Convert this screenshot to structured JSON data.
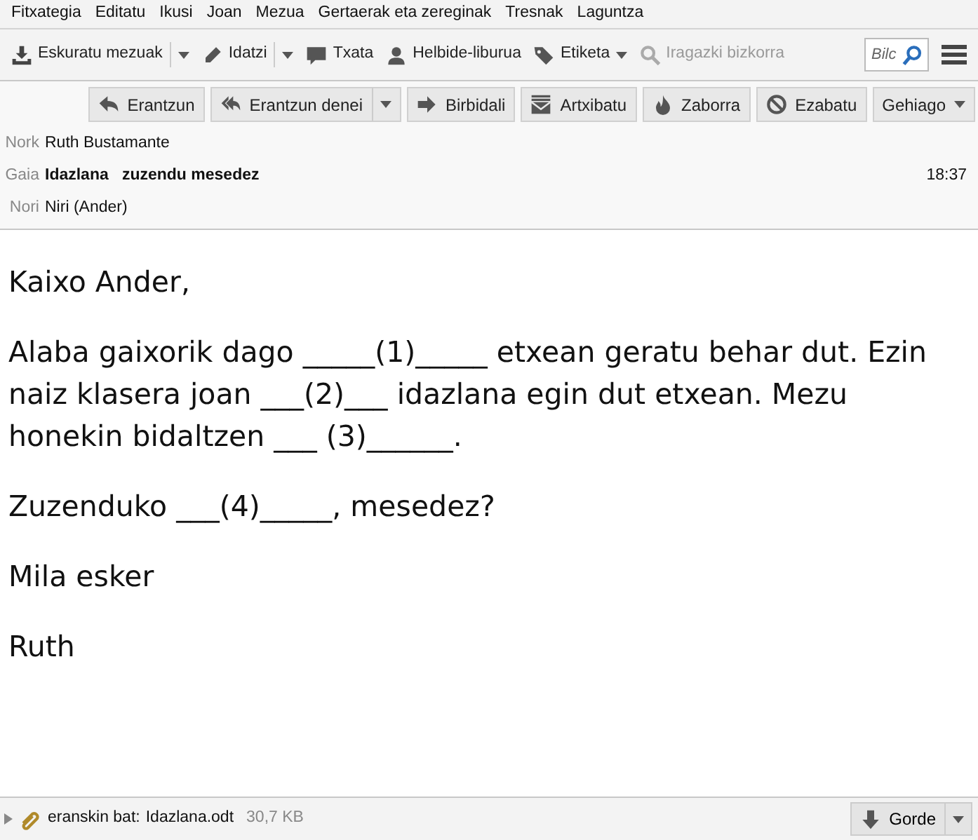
{
  "menu": [
    "Fitxategia",
    "Editatu",
    "Ikusi",
    "Joan",
    "Mezua",
    "Gertaerak eta zereginak",
    "Tresnak",
    "Laguntza"
  ],
  "toolbar": [
    {
      "kind": "split",
      "label": "Eskuratu mezuak"
    },
    {
      "kind": "split",
      "label": "Idatzi"
    },
    {
      "kind": "button",
      "label": "Txata"
    },
    {
      "kind": "button",
      "label": "Helbide-liburua"
    },
    {
      "kind": "menu",
      "label": "Etiketa"
    },
    {
      "kind": "disabled",
      "label": "Iragazki bizkorra"
    }
  ],
  "search": {
    "placeholder": "Bilc"
  },
  "actions": [
    {
      "kind": "button",
      "label": "Erantzun"
    },
    {
      "kind": "split",
      "label": "Erantzun denei"
    },
    {
      "kind": "button",
      "label": "Birbidali"
    },
    {
      "kind": "button",
      "label": "Artxibatu"
    },
    {
      "kind": "button",
      "label": "Zaborra"
    },
    {
      "kind": "button",
      "label": "Ezabatu"
    },
    {
      "kind": "menu",
      "label": "Gehiago"
    }
  ],
  "headers": [
    {
      "label": "Nork",
      "value": "Ruth Bustamante"
    },
    {
      "label": "Gaia",
      "value": "Idazlana   zuzendu mesedez",
      "bold": true,
      "time": "18:37"
    },
    {
      "label": "Nori",
      "value": "Niri (Ander)"
    }
  ],
  "body": [
    "Kaixo Ander,",
    "Alaba gaixorik dago _____(1)_____ etxean geratu behar dut. Ezin naiz klasera joan ___(2)___ idazlana egin dut etxean. Mezu honekin bidaltzen ___ (3)______.",
    "Zuzenduko ___(4)_____, mesedez?",
    "Mila esker",
    "Ruth"
  ],
  "attachment": {
    "expanded": false,
    "label": "eranskin bat:",
    "file": "Idazlana.odt",
    "size": "30,7 KB",
    "save": "Gorde"
  }
}
